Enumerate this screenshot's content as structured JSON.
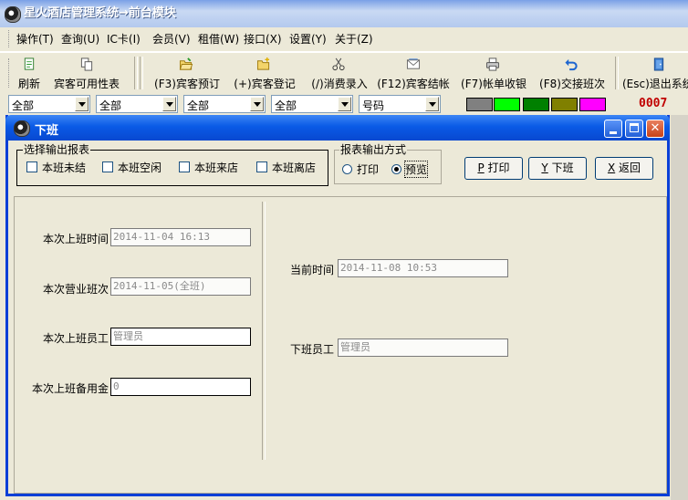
{
  "app": {
    "title": "星火酒店管理系统→前台模块"
  },
  "menu": [
    {
      "label": "操作(T)"
    },
    {
      "label": "查询(U)"
    },
    {
      "label": "IC卡(I)"
    },
    {
      "label": "会员(V)"
    },
    {
      "label": "租借(W)"
    },
    {
      "label": "接口(X)"
    },
    {
      "label": "设置(Y)"
    },
    {
      "label": "关于(Z)"
    }
  ],
  "toolbar": [
    {
      "label": "刷新",
      "icon": "document-refresh-icon"
    },
    {
      "label": "宾客可用性表",
      "icon": "copy-icon"
    },
    {
      "label": "(F3)宾客预订",
      "icon": "folder-open-icon"
    },
    {
      "label": "(+)宾客登记",
      "icon": "folder-new-icon"
    },
    {
      "label": "(/)消费录入",
      "icon": "scissors-icon"
    },
    {
      "label": "(F12)宾客结帐",
      "icon": "envelope-icon"
    },
    {
      "label": "(F7)帐单收银",
      "icon": "printer-icon"
    },
    {
      "label": "(F8)交接班次",
      "icon": "undo-arrow-icon"
    },
    {
      "label": "(Esc)退出系统",
      "icon": "exit-door-icon"
    }
  ],
  "filters": [
    {
      "value": "全部"
    },
    {
      "value": "全部"
    },
    {
      "value": "全部"
    },
    {
      "value": "全部"
    },
    {
      "value": "号码"
    }
  ],
  "status_colors": [
    "#808080",
    "#00ff00",
    "#008000",
    "#808000",
    "#ff00ff"
  ],
  "room_counter": "0007",
  "dialog": {
    "title": "下班",
    "report_group": {
      "legend": "选择输出报表",
      "options": [
        {
          "label": "本班未结",
          "checked": false
        },
        {
          "label": "本班空闲",
          "checked": false
        },
        {
          "label": "本班来店",
          "checked": false
        },
        {
          "label": "本班离店",
          "checked": false
        }
      ]
    },
    "output_group": {
      "legend": "报表输出方式",
      "options": [
        {
          "label": "打印",
          "selected": false
        },
        {
          "label": "预览",
          "selected": true
        }
      ]
    },
    "buttons": {
      "print": {
        "key": "P",
        "label": "打印"
      },
      "offduty": {
        "key": "Y",
        "label": "下班"
      },
      "back": {
        "key": "X",
        "label": "返回"
      }
    },
    "fields": {
      "last_on_time": {
        "label": "本次上班时间",
        "value": "2014-11-04 16:13"
      },
      "business_shift": {
        "label": "本次营业班次",
        "value": "2014-11-05(全班)"
      },
      "on_employee": {
        "label": "本次上班员工",
        "value": "管理员"
      },
      "petty_cash": {
        "label": "本次上班备用金",
        "value": "0"
      },
      "current_time": {
        "label": "当前时间",
        "value": "2014-11-08 10:53"
      },
      "off_employee": {
        "label": "下班员工",
        "value": "管理员"
      }
    }
  }
}
